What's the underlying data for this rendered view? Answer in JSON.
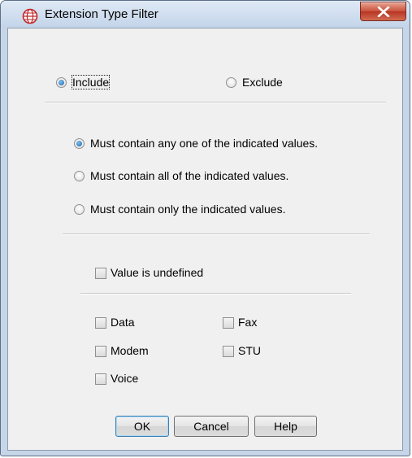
{
  "window": {
    "title": "Extension Type Filter",
    "app_icon": "globe-icon",
    "close_icon": "close-icon"
  },
  "mode": {
    "include_label": "Include",
    "exclude_label": "Exclude",
    "selected": "Include"
  },
  "match_options": {
    "items": [
      {
        "label": "Must contain any one of the indicated values.",
        "selected": true
      },
      {
        "label": "Must contain all of the indicated values.",
        "selected": false
      },
      {
        "label": "Must contain only the indicated values.",
        "selected": false
      }
    ]
  },
  "undefined_option": {
    "label": "Value is undefined",
    "checked": false
  },
  "types": {
    "items": [
      {
        "label": "Data",
        "checked": false
      },
      {
        "label": "Fax",
        "checked": false
      },
      {
        "label": "Modem",
        "checked": false
      },
      {
        "label": "STU",
        "checked": false
      },
      {
        "label": "Voice",
        "checked": false
      }
    ]
  },
  "buttons": {
    "ok": "OK",
    "cancel": "Cancel",
    "help": "Help"
  },
  "colors": {
    "accent": "#1c5fa8",
    "close_button": "#c8503a",
    "titlebar": "#c6d6e8"
  }
}
